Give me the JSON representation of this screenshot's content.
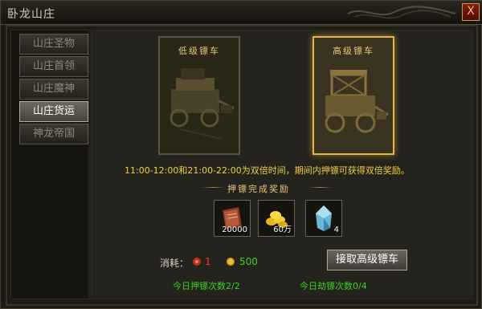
{
  "window": {
    "title": "卧龙山庄",
    "close_label": "X"
  },
  "sidebar": {
    "items": [
      {
        "label": "山庄圣物",
        "active": false
      },
      {
        "label": "山庄首领",
        "active": false
      },
      {
        "label": "山庄魔神",
        "active": false
      },
      {
        "label": "山庄货运",
        "active": true
      },
      {
        "label": "神龙帝国",
        "active": false
      }
    ]
  },
  "carts": {
    "low": {
      "title": "低级镖车",
      "icon": "cart-icon"
    },
    "high": {
      "title": "高级镖车",
      "icon": "cart-icon",
      "selected": true
    }
  },
  "double_note": "11:00-12:00和21:00-22:00为双倍时间，期间内押镖可获得双倍奖励。",
  "reward": {
    "title": "押镖完成奖励",
    "items": [
      {
        "icon": "book-icon",
        "qty": "20000"
      },
      {
        "icon": "gold-icon",
        "qty": "60万"
      },
      {
        "icon": "crystal-icon",
        "qty": "4"
      }
    ]
  },
  "cost": {
    "label": "消耗：",
    "item1": {
      "icon": "red-token-icon",
      "value": "1"
    },
    "item2": {
      "icon": "gold-coin-icon",
      "value": "500"
    }
  },
  "accept_button": "接取高级镖车",
  "counts": {
    "escort": "今日押镖次数2/2",
    "rob": "今日劫镖次数0/4"
  },
  "colors": {
    "highlight_gold": "#e0b84a",
    "note_yellow": "#f0d040",
    "count_green": "#3ad02a",
    "cost_red": "#ff3a2a"
  }
}
